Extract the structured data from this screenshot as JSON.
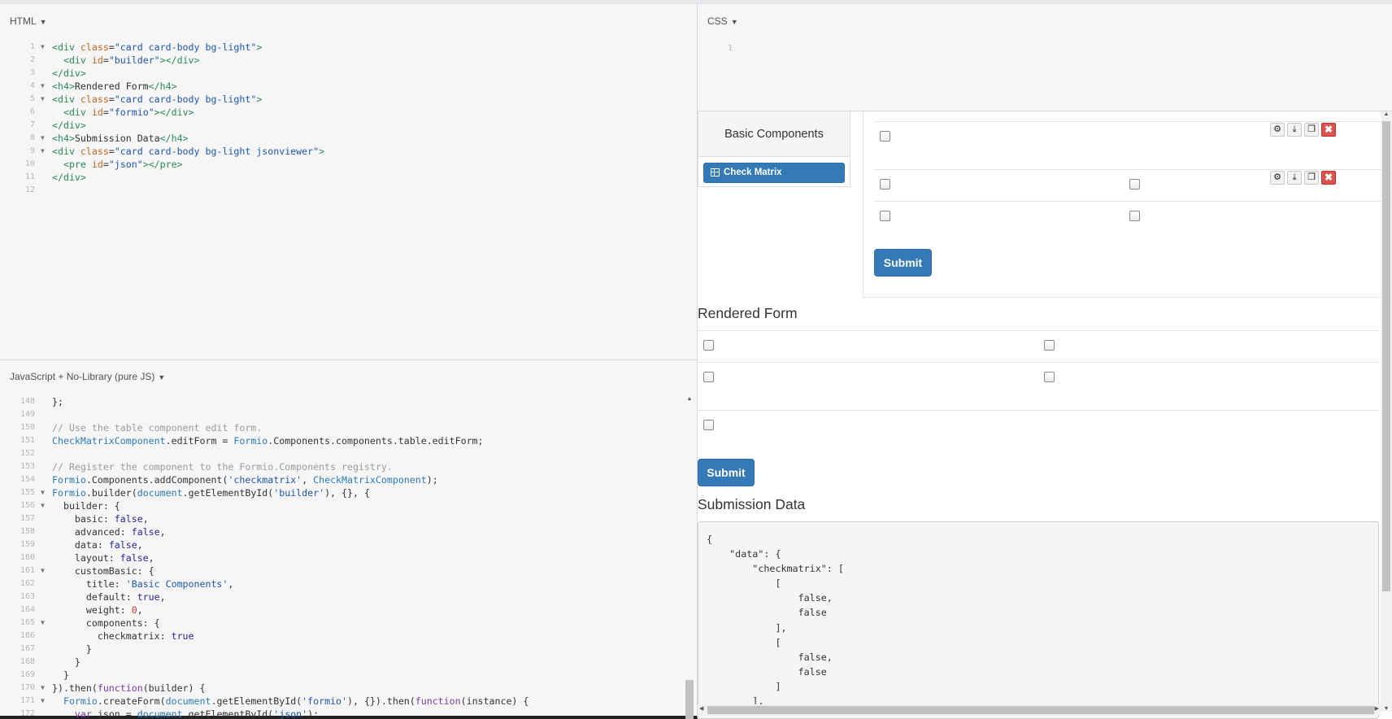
{
  "html_panel": {
    "label": "HTML",
    "lines": [
      {
        "n": "1",
        "fold": true,
        "html": "<span class=\"tag\">&lt;div</span> <span class=\"attr\">class</span>=<span class=\"str\">\"card card-body bg-light\"</span><span class=\"tag\">&gt;</span>"
      },
      {
        "n": "2",
        "fold": false,
        "html": "  <span class=\"tag\">&lt;div</span> <span class=\"attr\">id</span>=<span class=\"str\">\"builder\"</span><span class=\"tag\">&gt;&lt;/div&gt;</span>"
      },
      {
        "n": "3",
        "fold": false,
        "html": "<span class=\"tag\">&lt;/div&gt;</span>"
      },
      {
        "n": "4",
        "fold": true,
        "html": "<span class=\"tag\">&lt;h4&gt;</span>Rendered Form<span class=\"tag\">&lt;/h4&gt;</span>"
      },
      {
        "n": "5",
        "fold": true,
        "html": "<span class=\"tag\">&lt;div</span> <span class=\"attr\">class</span>=<span class=\"str\">\"card card-body bg-light\"</span><span class=\"tag\">&gt;</span>"
      },
      {
        "n": "6",
        "fold": false,
        "html": "  <span class=\"tag\">&lt;div</span> <span class=\"attr\">id</span>=<span class=\"str\">\"formio\"</span><span class=\"tag\">&gt;&lt;/div&gt;</span>"
      },
      {
        "n": "7",
        "fold": false,
        "html": "<span class=\"tag\">&lt;/div&gt;</span>"
      },
      {
        "n": "8",
        "fold": true,
        "html": "<span class=\"tag\">&lt;h4&gt;</span>Submission Data<span class=\"tag\">&lt;/h4&gt;</span>"
      },
      {
        "n": "9",
        "fold": true,
        "html": "<span class=\"tag\">&lt;div</span> <span class=\"attr\">class</span>=<span class=\"str\">\"card card-body bg-light jsonviewer\"</span><span class=\"tag\">&gt;</span>"
      },
      {
        "n": "10",
        "fold": false,
        "html": "  <span class=\"tag\">&lt;pre</span> <span class=\"attr\">id</span>=<span class=\"str\">\"json\"</span><span class=\"tag\">&gt;&lt;/pre&gt;</span>"
      },
      {
        "n": "11",
        "fold": false,
        "html": "<span class=\"tag\">&lt;/div&gt;</span>"
      },
      {
        "n": "12",
        "fold": false,
        "html": ""
      }
    ]
  },
  "css_panel": {
    "label": "CSS",
    "lines": [
      {
        "n": "1",
        "fold": false,
        "html": ""
      }
    ]
  },
  "js_panel": {
    "label": "JavaScript + No-Library (pure JS)",
    "lines": [
      {
        "n": "148",
        "fold": false,
        "html": "};"
      },
      {
        "n": "149",
        "fold": false,
        "html": ""
      },
      {
        "n": "150",
        "fold": false,
        "html": "<span class=\"cmt\">// Use the table component edit form.</span>"
      },
      {
        "n": "151",
        "fold": false,
        "html": "<span class=\"ref\">CheckMatrixComponent</span>.editForm = <span class=\"ref\">Formio</span>.Components.components.table.editForm;"
      },
      {
        "n": "152",
        "fold": false,
        "html": ""
      },
      {
        "n": "153",
        "fold": false,
        "html": "<span class=\"cmt\">// Register the component to the Formio.Components registry.</span>"
      },
      {
        "n": "154",
        "fold": false,
        "html": "<span class=\"ref\">Formio</span>.Components.addComponent(<span class=\"str\">'checkmatrix'</span>, <span class=\"ref\">CheckMatrixComponent</span>);"
      },
      {
        "n": "155",
        "fold": true,
        "html": "<span class=\"ref\">Formio</span>.builder(<span class=\"ref\">document</span>.getElementById(<span class=\"str\">'builder'</span>), {}, {"
      },
      {
        "n": "156",
        "fold": true,
        "html": "  builder: {"
      },
      {
        "n": "157",
        "fold": false,
        "html": "    basic: <span class=\"bool\">false</span>,"
      },
      {
        "n": "158",
        "fold": false,
        "html": "    advanced: <span class=\"bool\">false</span>,"
      },
      {
        "n": "159",
        "fold": false,
        "html": "    data: <span class=\"bool\">false</span>,"
      },
      {
        "n": "160",
        "fold": false,
        "html": "    layout: <span class=\"bool\">false</span>,"
      },
      {
        "n": "161",
        "fold": true,
        "html": "    customBasic: {"
      },
      {
        "n": "162",
        "fold": false,
        "html": "      title: <span class=\"str\">'Basic Components'</span>,"
      },
      {
        "n": "163",
        "fold": false,
        "html": "      default: <span class=\"bool\">true</span>,"
      },
      {
        "n": "164",
        "fold": false,
        "html": "      weight: <span class=\"num\">0</span>,"
      },
      {
        "n": "165",
        "fold": true,
        "html": "      components: {"
      },
      {
        "n": "166",
        "fold": false,
        "html": "        checkmatrix: <span class=\"bool\">true</span>"
      },
      {
        "n": "167",
        "fold": false,
        "html": "      }"
      },
      {
        "n": "168",
        "fold": false,
        "html": "    }"
      },
      {
        "n": "169",
        "fold": false,
        "html": "  }"
      },
      {
        "n": "170",
        "fold": true,
        "html": "}).then(<span class=\"kw\">function</span>(builder) {"
      },
      {
        "n": "171",
        "fold": true,
        "html": "  <span class=\"ref\">Formio</span>.createForm(<span class=\"ref\">document</span>.getElementById(<span class=\"str\">'formio'</span>), {}).then(<span class=\"kw\">function</span>(instance) {"
      },
      {
        "n": "172",
        "fold": false,
        "html": "    <span class=\"kw\">var</span> json = <span class=\"ref\">document</span>.getElementById(<span class=\"str\">'json'</span>);"
      }
    ]
  },
  "builder": {
    "sidebar_title": "Basic Components",
    "component_button": "Check Matrix",
    "submit_label": "Submit",
    "tool_icons": [
      "gear-icon",
      "move-icon",
      "copy-icon",
      "remove-icon"
    ],
    "tool_glyphs": [
      "⚙",
      "⤓",
      "❐",
      "✖"
    ]
  },
  "rendered": {
    "heading": "Rendered Form",
    "submit_label": "Submit"
  },
  "submission": {
    "heading": "Submission Data",
    "json_text": "{\n    \"data\": {\n        \"checkmatrix\": [\n            [\n                false,\n                false\n            ],\n            [\n                false,\n                false\n            ]\n        ],"
  }
}
